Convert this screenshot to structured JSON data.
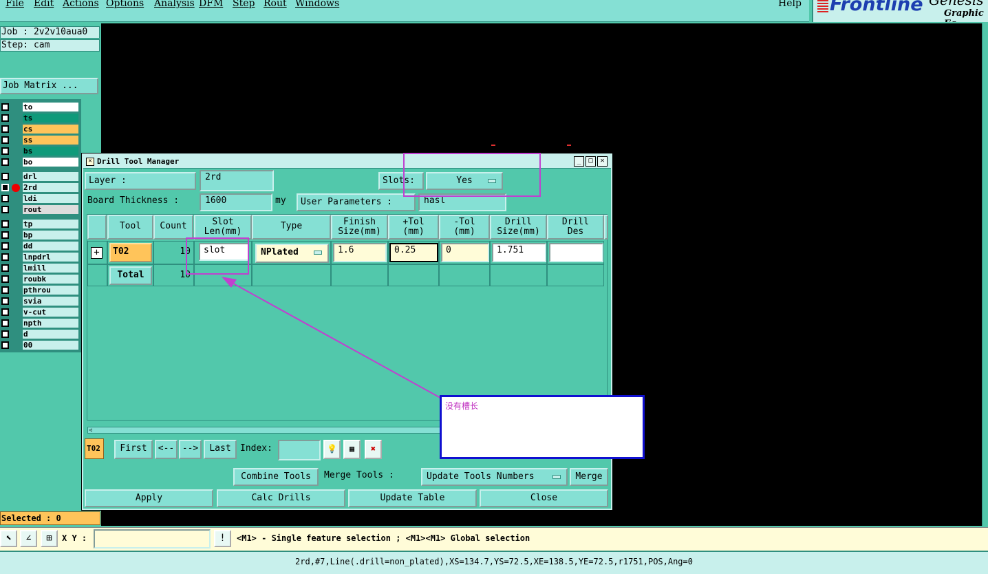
{
  "menu": [
    "File",
    "Edit",
    "Actions",
    "Options",
    "Analysis",
    "DFM",
    "Step",
    "Rout",
    "Windows"
  ],
  "help": "Help",
  "logo": {
    "name": "Frontline",
    "sub": "Graphic Ec",
    "top": "Genesis"
  },
  "job": {
    "job_line": "Job : 2v2v10aua0",
    "step_line": "Step: cam",
    "matrix_button": "Job Matrix ..."
  },
  "layers": [
    {
      "name": "to",
      "color": "#ffffff"
    },
    {
      "name": "ts",
      "color": "#0f9a7a"
    },
    {
      "name": "cs",
      "color": "#ffc45a"
    },
    {
      "name": "ss",
      "color": "#ffc45a"
    },
    {
      "name": "bs",
      "color": "#0f9a7a"
    },
    {
      "name": "bo",
      "color": "#ffffff"
    },
    {
      "name": "drl",
      "color": "#c8f0ec"
    },
    {
      "name": "2rd",
      "color": "#c8f0ec"
    },
    {
      "name": "ldi",
      "color": "#c8f0ec"
    },
    {
      "name": "rout",
      "color": "#dddddd"
    },
    {
      "name": "tp",
      "color": "#c8f0ec"
    },
    {
      "name": "bp",
      "color": "#c8f0ec"
    },
    {
      "name": "dd",
      "color": "#c8f0ec"
    },
    {
      "name": "lnpdrl",
      "color": "#c8f0ec"
    },
    {
      "name": "lmill",
      "color": "#c8f0ec"
    },
    {
      "name": "roubk",
      "color": "#c8f0ec"
    },
    {
      "name": "pthrou",
      "color": "#c8f0ec"
    },
    {
      "name": "svia",
      "color": "#c8f0ec"
    },
    {
      "name": "v-cut",
      "color": "#c8f0ec"
    },
    {
      "name": "npth",
      "color": "#c8f0ec"
    },
    {
      "name": "d",
      "color": "#c8f0ec"
    },
    {
      "name": "00",
      "color": "#c8f0ec"
    }
  ],
  "selected": "Selected : 0",
  "dialog": {
    "title": "Drill Tool Manager",
    "layer_label": "Layer          :",
    "layer_value": "2rd",
    "slots_label": "Slots:",
    "slots_value": "Yes",
    "board_label": "Board Thickness :",
    "board_value": "1600",
    "board_unit": "my",
    "user_params_label": "User Parameters :",
    "user_params_value": "hasl",
    "columns": [
      "Tool",
      "Count",
      "Slot\nLen(mm)",
      "Type",
      "Finish\nSize(mm)",
      "+Tol\n(mm)",
      "-Tol\n(mm)",
      "Drill\nSize(mm)",
      "Drill\nDes"
    ],
    "row": {
      "tool": "T02",
      "count": "10",
      "slot": "slot",
      "type": "NPlated",
      "finish": "1.6",
      "ptol": "0.25",
      "mtol": "0",
      "drill_size": "1.751",
      "drill_des": ""
    },
    "total_label": "Total",
    "total_count": "10",
    "nav": {
      "current": "T02",
      "first": "First",
      "prev": "<--",
      "next": "-->",
      "last": "Last",
      "index_label": "Index:"
    },
    "actions": {
      "combine": "Combine Tools",
      "merge_label": "Merge Tools  :",
      "update_option": "Update Tools Numbers",
      "merge": "Merge"
    },
    "bottom": {
      "apply": "Apply",
      "calc": "Calc Drills",
      "update": "Update Table",
      "close": "Close"
    }
  },
  "annotation": "没有槽长",
  "bottom_bar": {
    "xy_label": "X Y :",
    "message": "<M1> - Single feature selection ; <M1><M1> Global selection"
  },
  "status": "2rd,#7,Line(.drill=non_plated),XS=134.7,YS=72.5,XE=138.5,YE=72.5,r1751,POS,Ang=0"
}
